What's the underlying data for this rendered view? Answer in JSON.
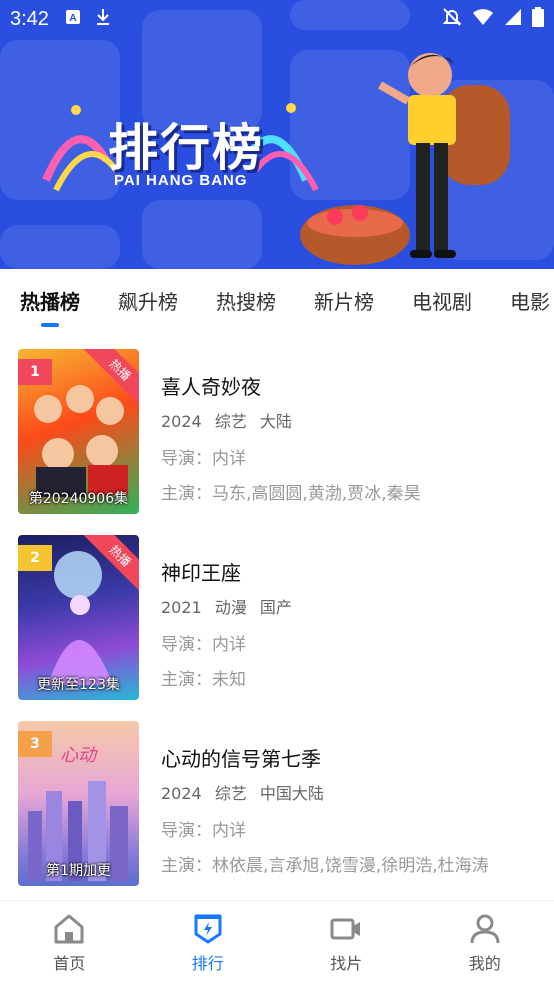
{
  "status_bar": {
    "time": "3:42",
    "left_icons": [
      "a-box-icon",
      "download-icon"
    ],
    "right_icons": [
      "bell-off-icon",
      "wifi-icon",
      "signal-icon",
      "battery-icon"
    ]
  },
  "banner": {
    "title": "排行榜",
    "subtitle": "PAI HANG BANG"
  },
  "tabs": [
    {
      "label": "热播榜",
      "active": true
    },
    {
      "label": "飙升榜",
      "active": false
    },
    {
      "label": "热搜榜",
      "active": false
    },
    {
      "label": "新片榜",
      "active": false
    },
    {
      "label": "电视剧",
      "active": false
    },
    {
      "label": "电影",
      "active": false
    }
  ],
  "items": [
    {
      "rank": "1",
      "rank_color": "#f0485a",
      "hot_label": "热播",
      "caption": "第20240906集",
      "title": "喜人奇妙夜",
      "year": "2024",
      "genre": "综艺",
      "region": "大陆",
      "director": "导演：内详",
      "cast": "主演：马东,高圆圆,黄渤,贾冰,秦昊"
    },
    {
      "rank": "2",
      "rank_color": "#f5c531",
      "hot_label": "热播",
      "caption": "更新至123集",
      "title": "神印王座",
      "year": "2021",
      "genre": "动漫",
      "region": "国产",
      "director": "导演：内详",
      "cast": "主演：未知"
    },
    {
      "rank": "3",
      "rank_color": "#f5a04a",
      "hot_label": "",
      "caption": "第1期加更",
      "title": "心动的信号第七季",
      "year": "2024",
      "genre": "综艺",
      "region": "中国大陆",
      "director": "导演：内详",
      "cast": "主演：林依晨,言承旭,饶雪漫,徐明浩,杜海涛"
    }
  ],
  "bottom_nav": [
    {
      "label": "首页",
      "icon": "home-icon",
      "active": false
    },
    {
      "label": "排行",
      "icon": "ranking-shield-icon",
      "active": true
    },
    {
      "label": "找片",
      "icon": "video-camera-icon",
      "active": false
    },
    {
      "label": "我的",
      "icon": "user-icon",
      "active": false
    }
  ],
  "colors": {
    "accent": "#1677ff",
    "banner_bg": "#2a4fe0",
    "hot": "#f0485a"
  }
}
